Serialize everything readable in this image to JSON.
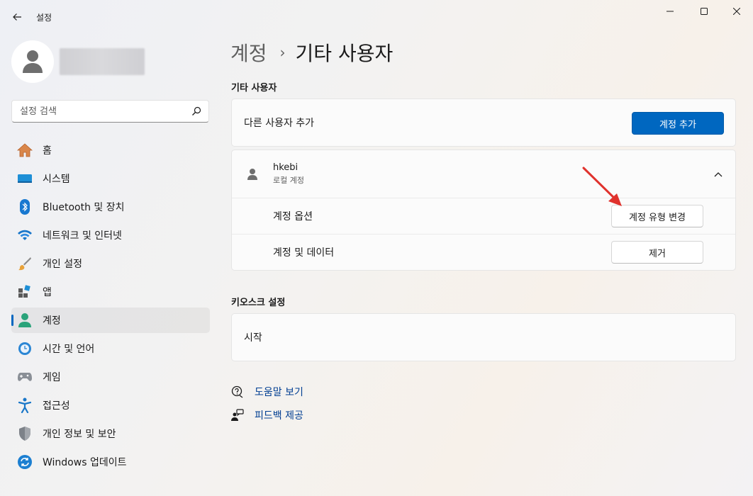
{
  "app": {
    "title": "설정"
  },
  "search": {
    "placeholder": "설정 검색"
  },
  "sidebar": {
    "items": [
      {
        "label": "홈",
        "icon": "home-icon"
      },
      {
        "label": "시스템",
        "icon": "system-icon"
      },
      {
        "label": "Bluetooth 및 장치",
        "icon": "bluetooth-icon"
      },
      {
        "label": "네트워크 및 인터넷",
        "icon": "wifi-icon"
      },
      {
        "label": "개인 설정",
        "icon": "brush-icon"
      },
      {
        "label": "앱",
        "icon": "apps-icon"
      },
      {
        "label": "계정",
        "icon": "account-icon",
        "active": true
      },
      {
        "label": "시간 및 언어",
        "icon": "time-language-icon"
      },
      {
        "label": "게임",
        "icon": "gamepad-icon"
      },
      {
        "label": "접근성",
        "icon": "accessibility-icon"
      },
      {
        "label": "개인 정보 및 보안",
        "icon": "shield-icon"
      },
      {
        "label": "Windows 업데이트",
        "icon": "update-icon"
      }
    ]
  },
  "breadcrumb": {
    "parent": "계정",
    "separator": "›",
    "current": "기타 사용자"
  },
  "other_users": {
    "section_title": "기타 사용자",
    "add_label": "다른 사용자 추가",
    "add_button": "계정 추가",
    "user": {
      "name": "hkebi",
      "type": "로컬 계정",
      "options_label": "계정 옵션",
      "change_type_button": "계정 유형 변경",
      "data_label": "계정 및 데이터",
      "remove_button": "제거"
    }
  },
  "kiosk": {
    "section_title": "키오스크 설정",
    "start_label": "시작"
  },
  "help": {
    "get_help": "도움말 보기",
    "feedback": "피드백 제공"
  },
  "colors": {
    "accent": "#0067c0",
    "link": "#003e92",
    "annotation_arrow": "#e0322d"
  }
}
